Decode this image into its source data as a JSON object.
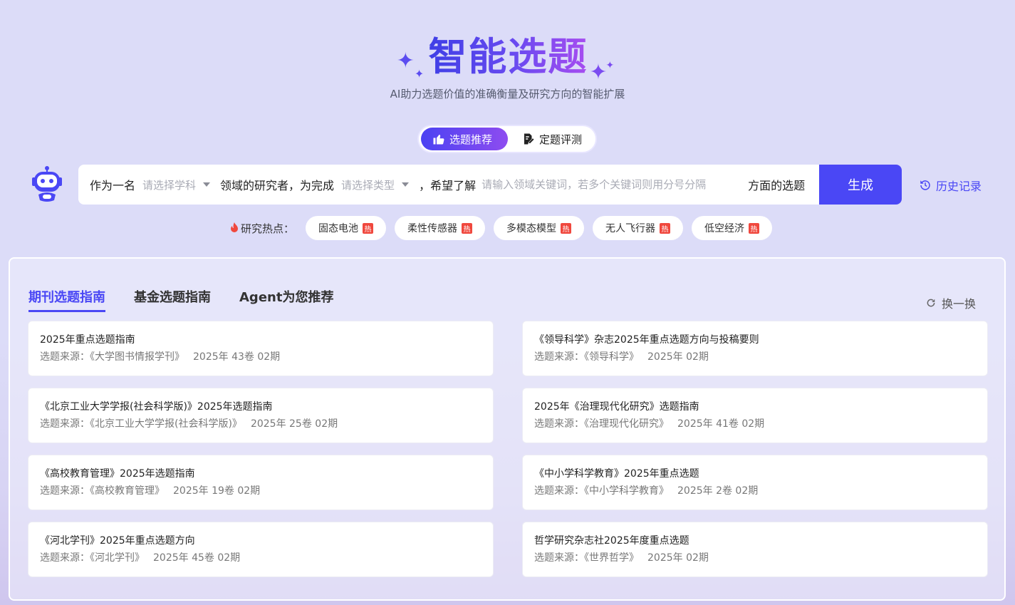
{
  "hero": {
    "title": "智能选题",
    "subtitle": "AI助力选题价值的准确衡量及研究方向的智能扩展"
  },
  "mode_switch": {
    "recommend_label": "选题推荐",
    "evaluate_label": "定题评测"
  },
  "search": {
    "prefix": "作为一名",
    "subject_placeholder": "请选择学科",
    "middle": "领域的研究者，为完成",
    "type_placeholder": "请选择类型",
    "hope": "，希望了解",
    "keyword_placeholder": "请输入领域关键词，若多个关键词则用分号分隔",
    "suffix": "方面的选题",
    "generate_label": "生成",
    "history_label": "历史记录"
  },
  "hot": {
    "label": "研究热点：",
    "badge": "热",
    "topics": [
      "固态电池",
      "柔性传感器",
      "多模态模型",
      "无人飞行器",
      "低空经济"
    ]
  },
  "panel": {
    "tabs": [
      "期刊选题指南",
      "基金选题指南",
      "Agent为您推荐"
    ],
    "refresh_label": "换一换",
    "source_prefix": "选题来源：",
    "cards": [
      {
        "title": "2025年重点选题指南",
        "source": "《大学图书情报学刊》",
        "issue": "2025年 43卷 02期"
      },
      {
        "title": "《领导科学》杂志2025年重点选题方向与投稿要则",
        "source": "《领导科学》",
        "issue": "2025年 02期"
      },
      {
        "title": "《北京工业大学学报(社会科学版)》2025年选题指南",
        "source": "《北京工业大学学报(社会科学版)》",
        "issue": "2025年 25卷 02期"
      },
      {
        "title": "2025年《治理现代化研究》选题指南",
        "source": "《治理现代化研究》",
        "issue": "2025年 41卷 02期"
      },
      {
        "title": "《高校教育管理》2025年选题指南",
        "source": "《高校教育管理》",
        "issue": "2025年 19卷 02期"
      },
      {
        "title": "《中小学科学教育》2025年重点选题",
        "source": "《中小学科学教育》",
        "issue": "2025年 2卷 02期"
      },
      {
        "title": "《河北学刊》2025年重点选题方向",
        "source": "《河北学刊》",
        "issue": "2025年 45卷 02期"
      },
      {
        "title": "哲学研究杂志社2025年度重点选题",
        "source": "《世界哲学》",
        "issue": "2025年 02期"
      }
    ]
  },
  "colors": {
    "accent": "#4a47f5",
    "hot_badge": "#f0483e"
  }
}
